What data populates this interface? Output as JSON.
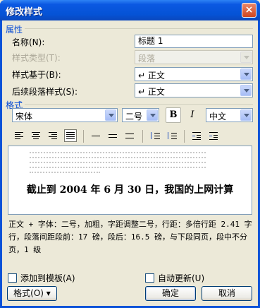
{
  "window": {
    "title": "修改样式",
    "close": "×"
  },
  "properties": {
    "group_label": "属性",
    "name_label": "名称(N):",
    "name_value": "标题 1",
    "type_label": "样式类型(T):",
    "type_value": "段落",
    "based_on_label": "样式基于(B):",
    "based_on_value": "↵ 正文",
    "next_label": "后续段落样式(S):",
    "next_value": "↵ 正文"
  },
  "format": {
    "group_label": "格式",
    "font": "宋体",
    "size": "二号",
    "bold": "B",
    "italic": "I",
    "language": "中文"
  },
  "preview": {
    "sample_text": "截止到 2004 年 6 月 30 日，我国的上网计算",
    "prev_text": "前一段落前一段落前一段落前一段落前一段落前一段落前一段落前一段落前一段落前一段落"
  },
  "description": "正文 + 字体：二号，加粗，字距调整二号，行距：多倍行距 2.41 字行，段落间距段前：17 磅，段后：16.5 磅，与下段同页，段中不分页，1 级",
  "options": {
    "add_template": "添加到模板(A)",
    "auto_update": "自动更新(U)"
  },
  "buttons": {
    "format": "格式(O) ▾",
    "ok": "确定",
    "cancel": "取消"
  }
}
